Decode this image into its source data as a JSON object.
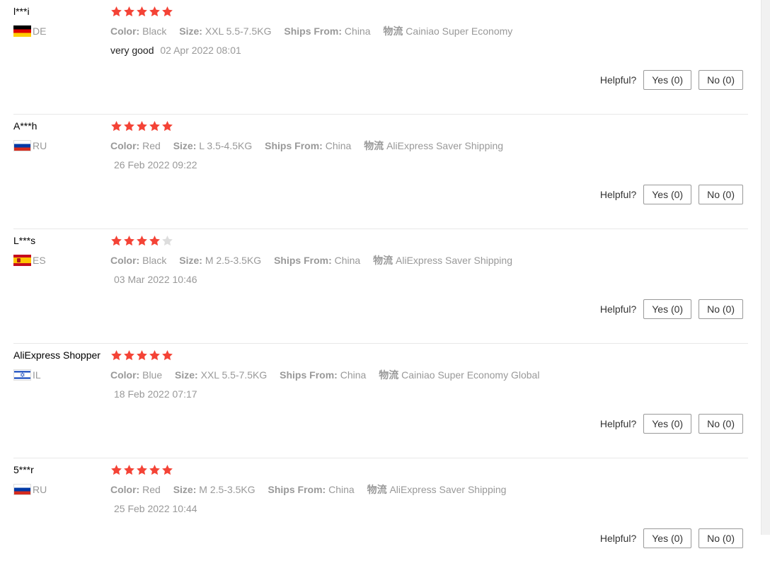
{
  "labels": {
    "color": "Color:",
    "size": "Size:",
    "ships_from": "Ships From:",
    "logistics": "物流",
    "helpful": "Helpful?"
  },
  "colors": {
    "star_filled": "#f44336",
    "star_empty": "#dddddd"
  },
  "reviews": [
    {
      "user": "l***i",
      "country": "DE",
      "flag_icon": "germany-flag-icon",
      "rating": 5,
      "color": "Black",
      "size": "XXL 5.5-7.5KG",
      "ships_from": "China",
      "logistics": "Cainiao Super Economy",
      "text": "very good",
      "date": "02 Apr 2022 08:01",
      "yes": "Yes (0)",
      "no": "No (0)"
    },
    {
      "user": "A***h",
      "country": "RU",
      "flag_icon": "russia-flag-icon",
      "rating": 5,
      "color": "Red",
      "size": "L 3.5-4.5KG",
      "ships_from": "China",
      "logistics": "AliExpress Saver Shipping",
      "text": "",
      "date": "26 Feb 2022 09:22",
      "yes": "Yes (0)",
      "no": "No (0)"
    },
    {
      "user": "L***s",
      "country": "ES",
      "flag_icon": "spain-flag-icon",
      "rating": 4,
      "color": "Black",
      "size": "M 2.5-3.5KG",
      "ships_from": "China",
      "logistics": "AliExpress Saver Shipping",
      "text": "",
      "date": "03 Mar 2022 10:46",
      "yes": "Yes (0)",
      "no": "No (0)"
    },
    {
      "user": "AliExpress Shopper",
      "country": "IL",
      "flag_icon": "israel-flag-icon",
      "rating": 5,
      "color": "Blue",
      "size": "XXL 5.5-7.5KG",
      "ships_from": "China",
      "logistics": "Cainiao Super Economy Global",
      "text": "",
      "date": "18 Feb 2022 07:17",
      "yes": "Yes (0)",
      "no": "No (0)"
    },
    {
      "user": "5***r",
      "country": "RU",
      "flag_icon": "russia-flag-icon",
      "rating": 5,
      "color": "Red",
      "size": "M 2.5-3.5KG",
      "ships_from": "China",
      "logistics": "AliExpress Saver Shipping",
      "text": "",
      "date": "25 Feb 2022 10:44",
      "yes": "Yes (0)",
      "no": "No (0)"
    }
  ]
}
